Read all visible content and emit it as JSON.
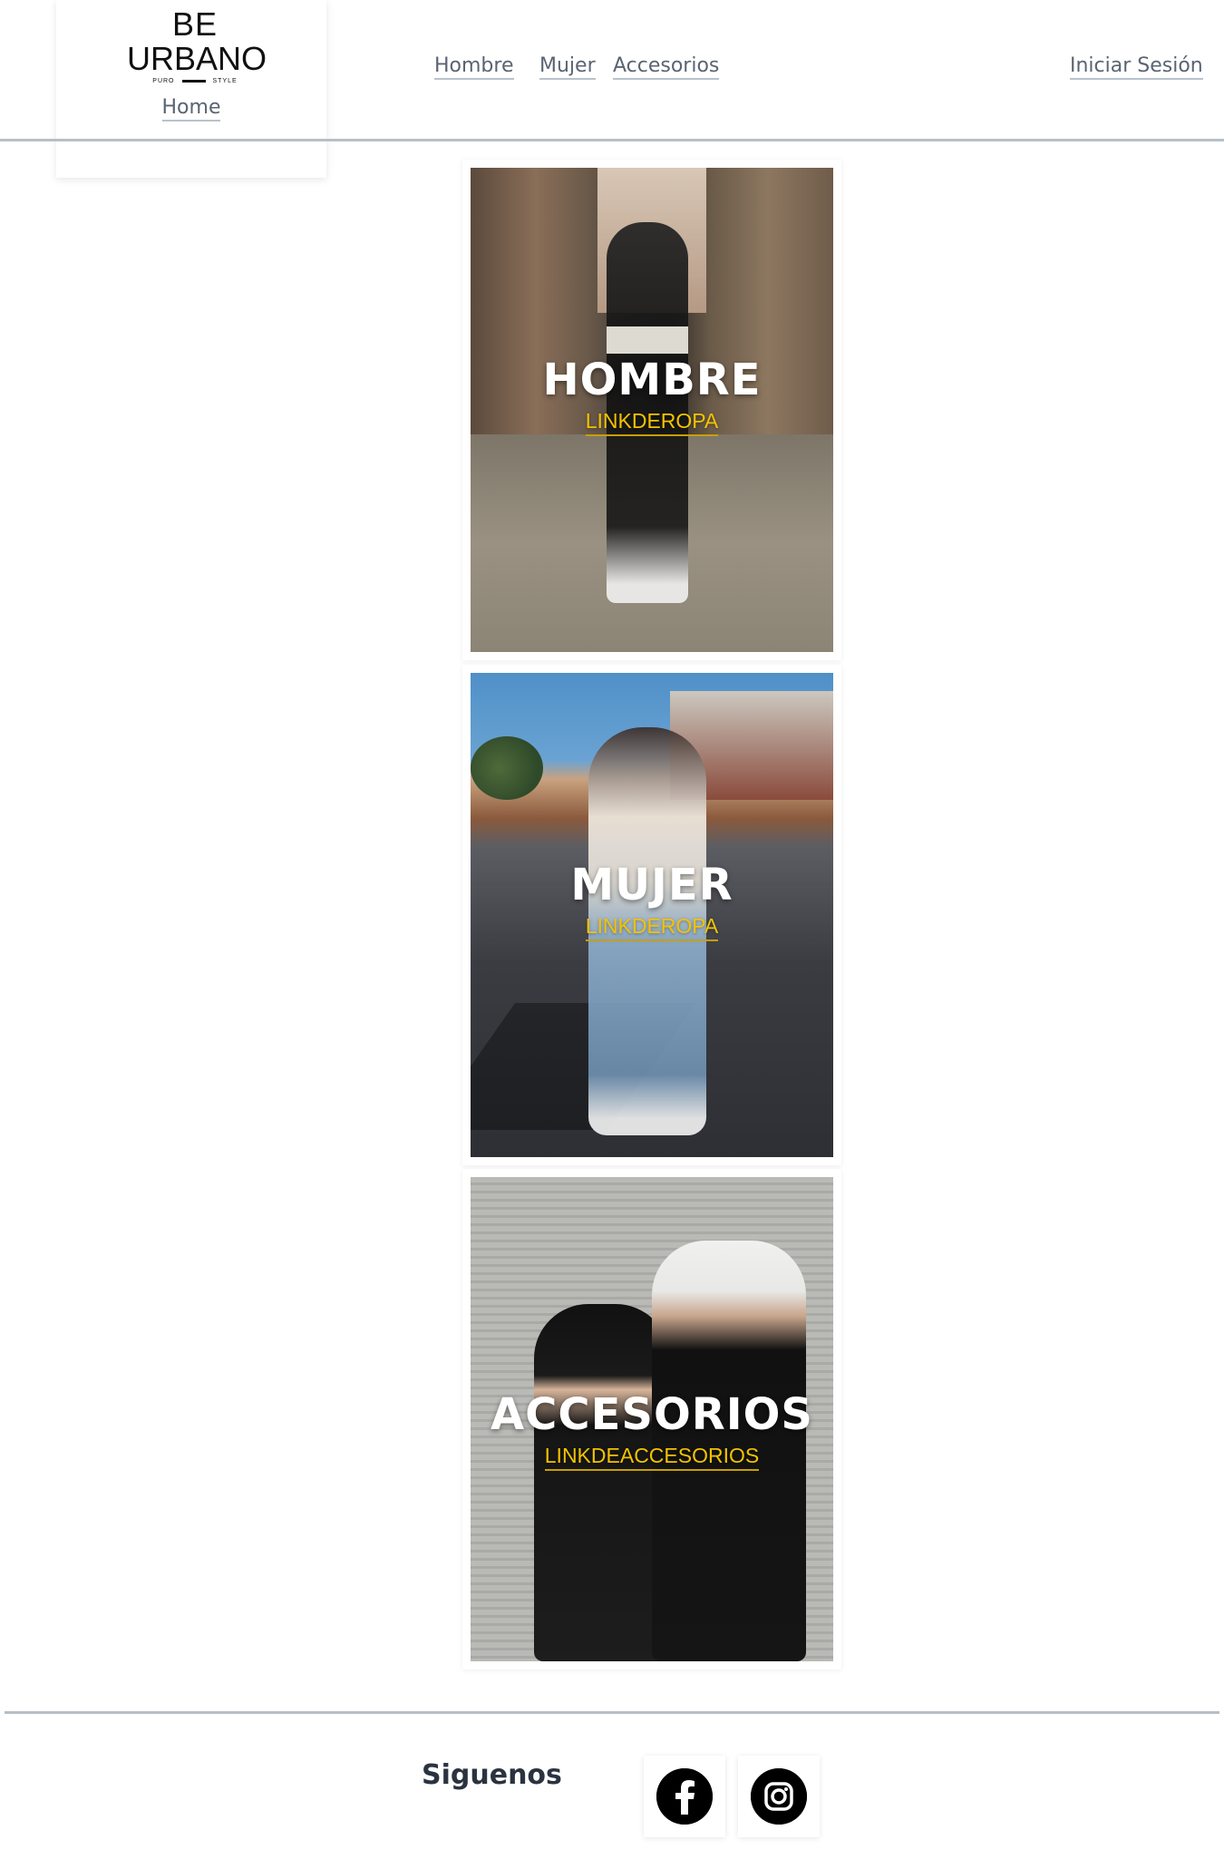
{
  "brand": {
    "line1": "BE",
    "line2": "URBANO",
    "tag_left": "PURO",
    "tag_right": "STYLE"
  },
  "header": {
    "home_label": "Home",
    "nav": {
      "hombre": "Hombre",
      "mujer": "Mujer",
      "accesorios": "Accesorios"
    },
    "login_label": "Iniciar Sesión"
  },
  "categories": [
    {
      "title": "HOMBRE",
      "link": "LINKDEROPA"
    },
    {
      "title": "MUJER",
      "link": "LINKDEROPA"
    },
    {
      "title": "ACCESORIOS",
      "link": "LINKDEACCESORIOS"
    }
  ],
  "footer": {
    "follow_label": "Siguenos",
    "social": [
      {
        "name": "facebook-icon"
      },
      {
        "name": "instagram-icon"
      }
    ]
  }
}
